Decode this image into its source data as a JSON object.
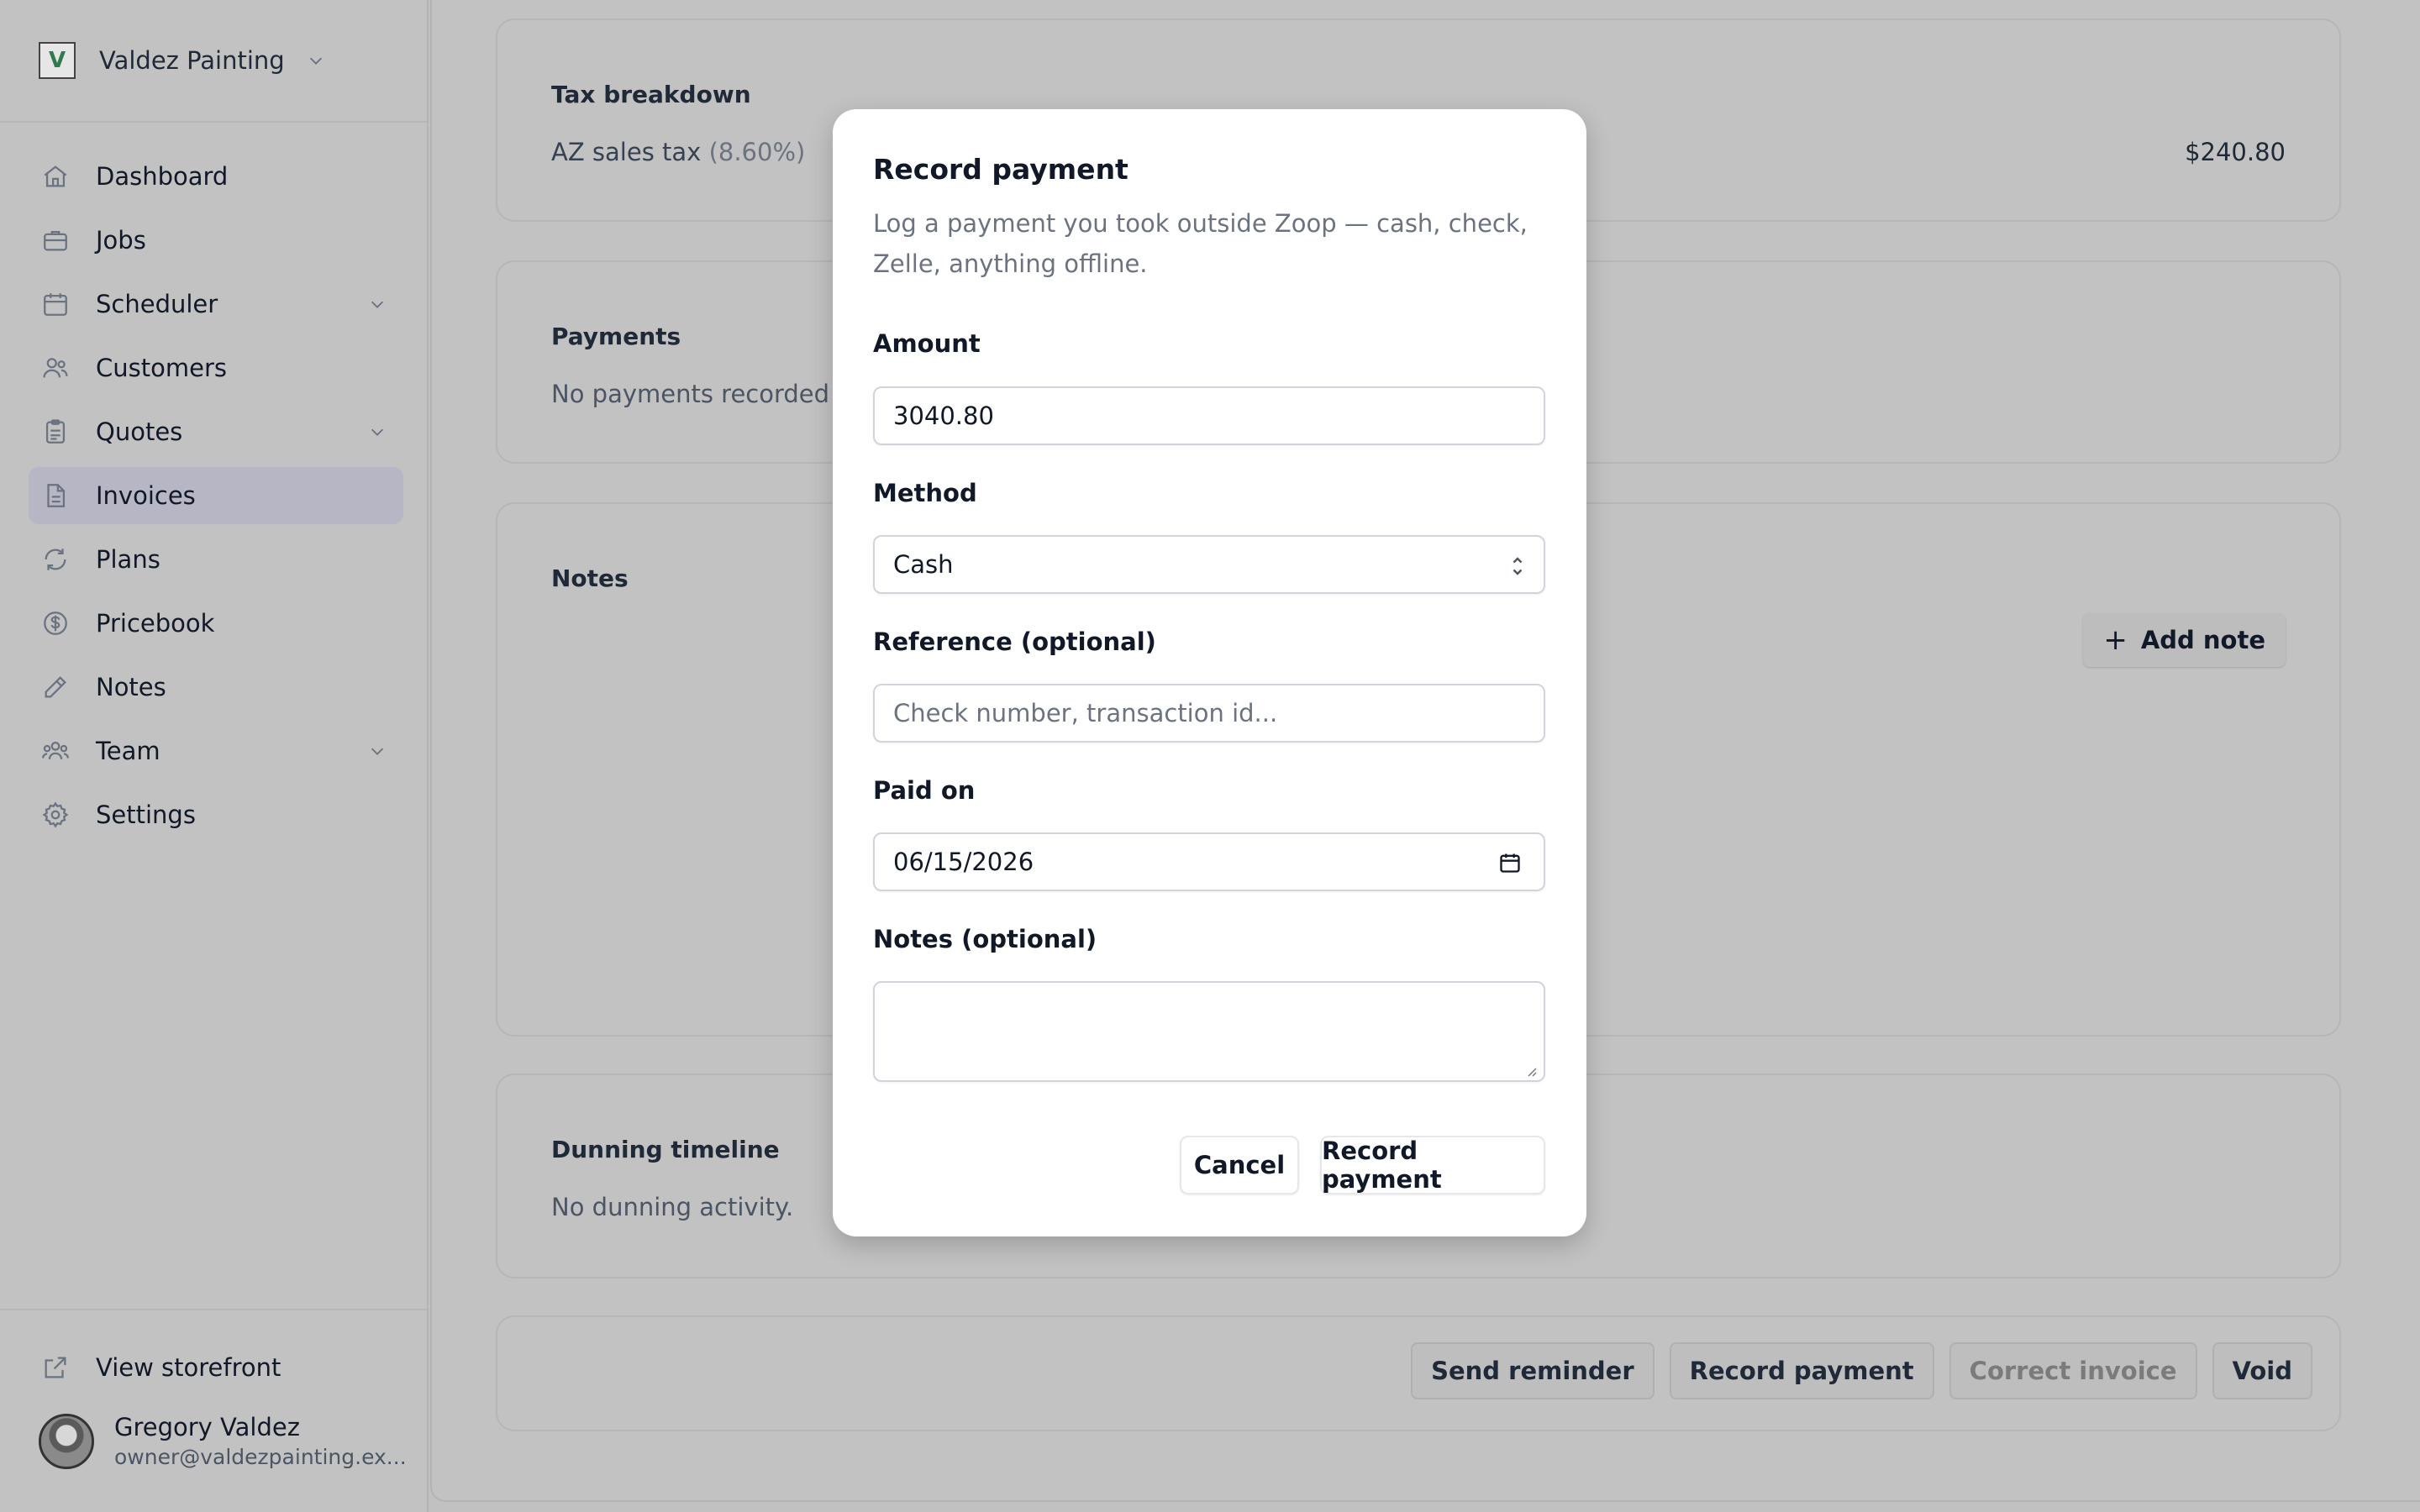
{
  "sidebar": {
    "brand": {
      "name": "Valdez Painting",
      "logo_letter": "V"
    },
    "nav": [
      {
        "label": "Dashboard",
        "icon": "home-icon"
      },
      {
        "label": "Jobs",
        "icon": "briefcase-icon"
      },
      {
        "label": "Scheduler",
        "icon": "calendar-icon",
        "expandable": true
      },
      {
        "label": "Customers",
        "icon": "users-icon"
      },
      {
        "label": "Quotes",
        "icon": "clipboard-icon",
        "expandable": true
      },
      {
        "label": "Invoices",
        "icon": "document-icon",
        "active": true
      },
      {
        "label": "Plans",
        "icon": "refresh-icon"
      },
      {
        "label": "Pricebook",
        "icon": "dollar-icon"
      },
      {
        "label": "Notes",
        "icon": "pencil-icon"
      },
      {
        "label": "Team",
        "icon": "team-icon",
        "expandable": true
      },
      {
        "label": "Settings",
        "icon": "gear-icon"
      }
    ],
    "storefront_label": "View storefront",
    "user": {
      "name": "Gregory Valdez",
      "email": "owner@valdezpainting.ex..."
    }
  },
  "main": {
    "tax": {
      "title": "Tax breakdown",
      "label": "AZ sales tax",
      "rate": "(8.60%)",
      "amount": "$240.80"
    },
    "payments": {
      "title": "Payments",
      "empty_text": "No payments recorded ye"
    },
    "notes": {
      "title": "Notes",
      "add_label": "Add note"
    },
    "dunning": {
      "title": "Dunning timeline",
      "empty_text": "No dunning activity."
    },
    "actions": {
      "send_reminder": "Send reminder",
      "record_payment": "Record payment",
      "correct_invoice": "Correct invoice",
      "void": "Void"
    }
  },
  "modal": {
    "title": "Record payment",
    "description": "Log a payment you took outside Zoop — cash, check, Zelle, anything offline.",
    "amount": {
      "label": "Amount",
      "value": "3040.80"
    },
    "method": {
      "label": "Method",
      "value": "Cash"
    },
    "reference": {
      "label": "Reference (optional)",
      "placeholder": "Check number, transaction id..."
    },
    "paid_on": {
      "label": "Paid on",
      "value": "06/15/2026"
    },
    "notes": {
      "label": "Notes (optional)",
      "value": ""
    },
    "cancel_label": "Cancel",
    "submit_label": "Record payment"
  },
  "colors": {
    "active_nav": "#b7b6c4",
    "overlay": "#c1c1c1",
    "modal_bg": "#ffffff"
  }
}
